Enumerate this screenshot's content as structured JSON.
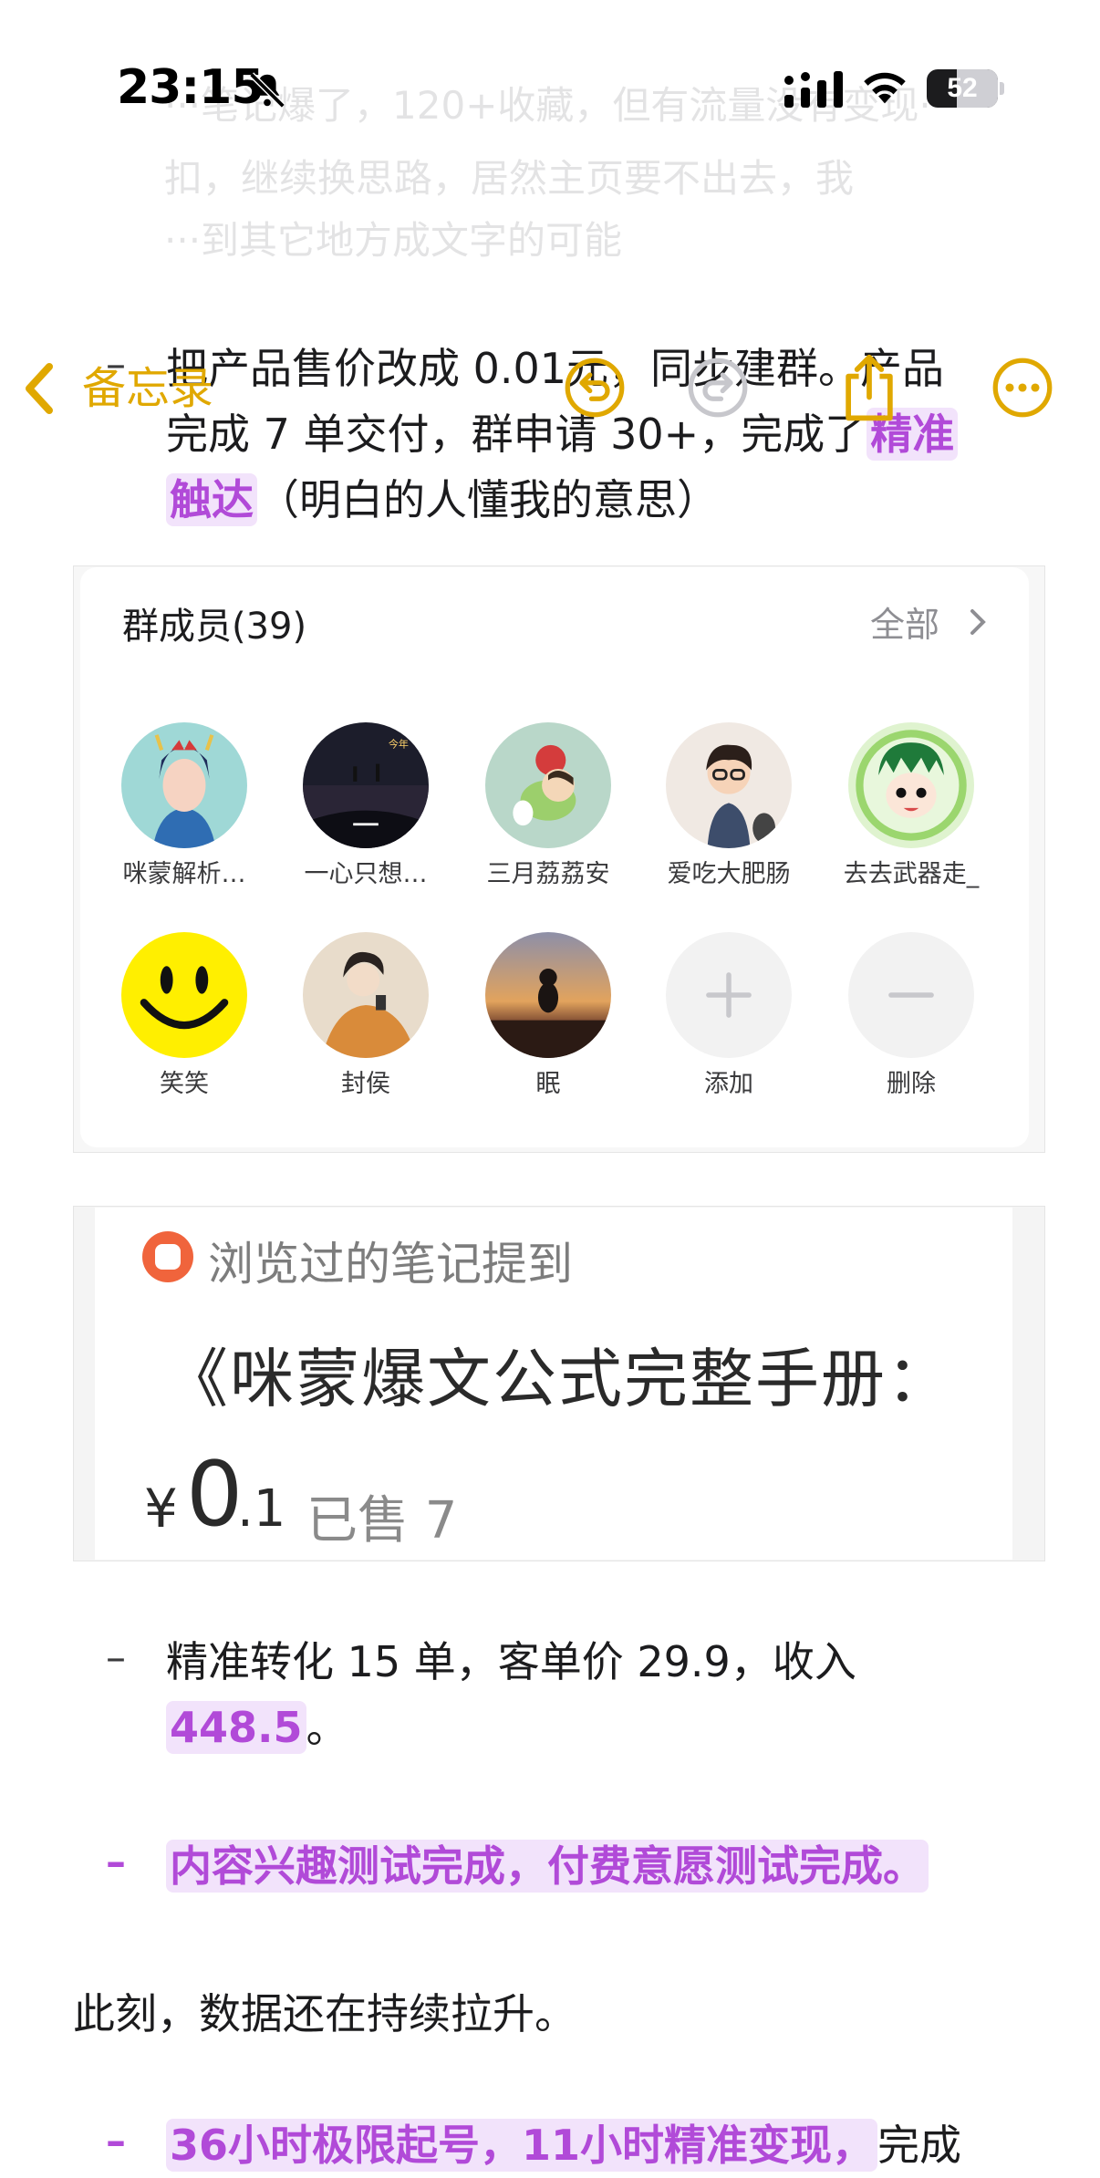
{
  "status": {
    "time": "23:15",
    "battery": "52"
  },
  "nav": {
    "back_label": "备忘录"
  },
  "ghost_lines": [
    "···笔记爆了，120+收藏，但有流量没有变现·",
    "扣，继续换思路，居然主页要不出去，我",
    "···到其它地方成文字的可能"
  ],
  "bullet1": {
    "dash": "–",
    "line1": "把产品售价改成 0.01元，同步建群。产品",
    "line2_plain": "完成 7 单交付，群申请 30+，完成了",
    "line2_hl": "精准",
    "line3_hl": "触达",
    "line3_plain": "（明白的人懂我的意思）"
  },
  "members": {
    "title": "群成员(39)",
    "all_label": "全部",
    "row1": [
      "咪蒙解析…",
      "一心只想…",
      "三月荔荔安",
      "爱吃大肥肠",
      "去去武器走_"
    ],
    "row2": [
      "笑笑",
      "封侯",
      "眠",
      "添加",
      "删除"
    ]
  },
  "product": {
    "mention": "浏览过的笔记提到",
    "title": "《咪蒙爆文公式完整手册：",
    "currency": "¥",
    "price_int": "0",
    "price_dec": ".1",
    "sold": "已售 7"
  },
  "bullet2": {
    "dash": "–",
    "line1": "精准转化 15 单，客单价 29.9，收入",
    "hl": "448.5",
    "tail": "。"
  },
  "bullet3": {
    "dash": "–",
    "hl": "内容兴趣测试完成，付费意愿测试完成。"
  },
  "para": "此刻，数据还在持续拉升。",
  "bullet4": {
    "dash": "–",
    "hl": "36小时极限起号，11小时精准变现，",
    "tail": "完成"
  },
  "colors": {
    "accent": "#e0a800",
    "highlight_bg": "#f2e3fb",
    "highlight_text": "#b14ad8"
  }
}
